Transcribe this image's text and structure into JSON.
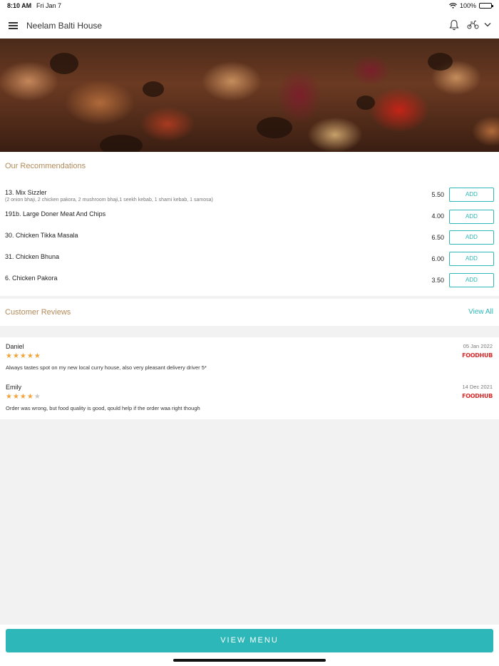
{
  "status_bar": {
    "time": "8:10 AM",
    "date": "Fri Jan 7",
    "battery": "100%"
  },
  "header": {
    "title": "Neelam Balti House"
  },
  "recommendations": {
    "title": "Our Recommendations",
    "add_label": "ADD",
    "items": [
      {
        "name": "13. Mix Sizzler",
        "desc": "(2 onion bhaji, 2 chicken pakora, 2 mushroom bhaji,1 seekh kebab, 1 shami kebab, 1 samosa)",
        "price": "5.50"
      },
      {
        "name": "191b. Large Doner Meat And Chips",
        "desc": "",
        "price": "4.00"
      },
      {
        "name": "30. Chicken Tikka Masala",
        "desc": "",
        "price": "6.50"
      },
      {
        "name": "31. Chicken Bhuna",
        "desc": "",
        "price": "6.00"
      },
      {
        "name": "6. Chicken Pakora",
        "desc": "",
        "price": "3.50"
      }
    ]
  },
  "reviews": {
    "title": "Customer Reviews",
    "view_all": "View All",
    "source_logo": "FOODHUB",
    "items": [
      {
        "name": "Daniel",
        "rating": 5,
        "date": "05 Jan 2022",
        "text": "Always tastes spot on my new local curry house, also very pleasant delivery driver 5*"
      },
      {
        "name": "Emily",
        "rating": 4,
        "date": "14 Dec 2021",
        "text": "Order was wrong, but food quality is good, qould help if the order waa right though"
      }
    ]
  },
  "footer": {
    "view_menu": "VIEW MENU"
  },
  "colors": {
    "accent": "#2db7b8",
    "section_title": "#b38a5a",
    "star": "#f2a33a",
    "foodhub": "#d62b2b"
  }
}
